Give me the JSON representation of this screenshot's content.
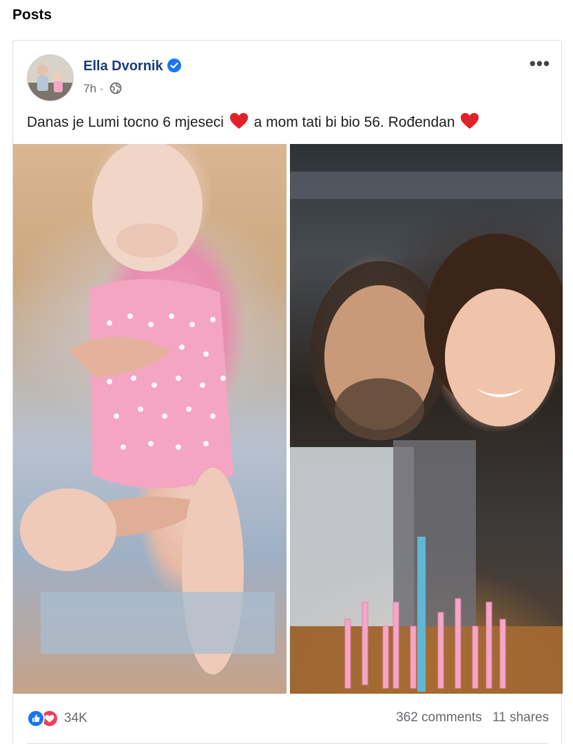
{
  "section": {
    "title": "Posts"
  },
  "post": {
    "author": "Ella Dvornik",
    "verified_icon": "verified-badge-icon",
    "time": "7h",
    "separator": "·",
    "privacy_icon": "globe-icon",
    "more_label": "•••",
    "text_part1": "Danas je Lumi tocno 6 mjeseci",
    "text_part2": "a mom tati bi bio 56. Rođendan",
    "emoji": "red-heart",
    "photos": [
      {
        "name": "photo-baby-pink-onesie"
      },
      {
        "name": "photo-father-daughter-birthday"
      }
    ],
    "reactions": {
      "icons": [
        "like-icon",
        "love-icon"
      ],
      "count": "34K"
    },
    "comments": "362 comments",
    "shares": "11 shares"
  },
  "colors": {
    "link_blue": "#1c3b7a",
    "verified_blue": "#1877f2",
    "like_blue": "#1877f2",
    "love_red": "#f33e58",
    "heart_red": "#e0212a",
    "secondary_text": "#65676b"
  }
}
